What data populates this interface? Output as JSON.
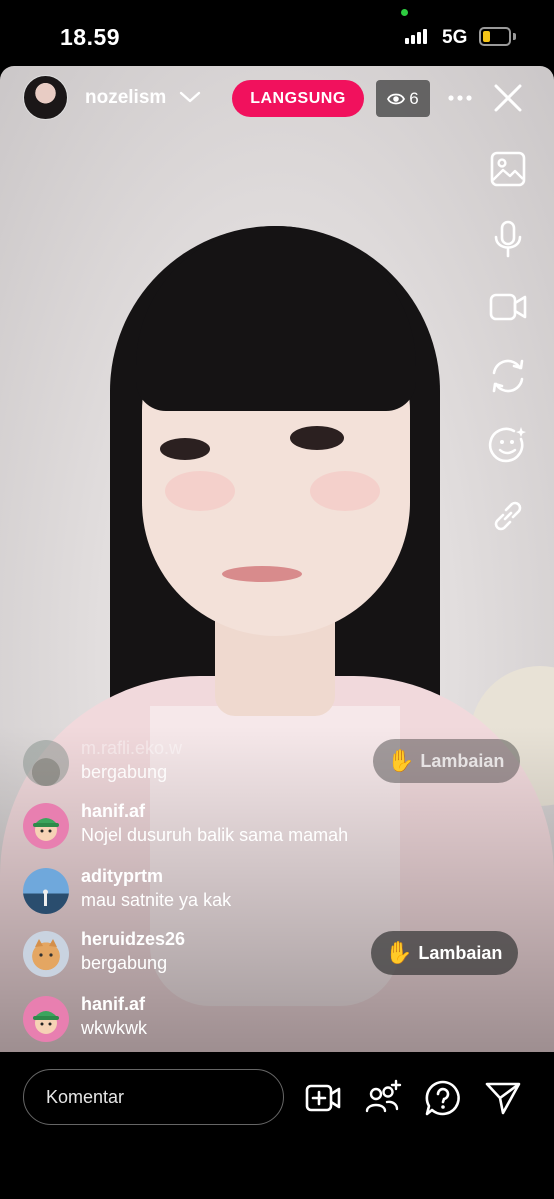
{
  "status_bar": {
    "time": "18.59",
    "network": "5G"
  },
  "header": {
    "host_name": "nozelism",
    "live_label": "LANGSUNG",
    "viewer_count": "6"
  },
  "chat": [
    {
      "user": "m.rafli.eko.w",
      "text": "bergabung"
    },
    {
      "user": "hanif.af",
      "text": "Nojel dusuruh balik sama mamah"
    },
    {
      "user": "adityprtm",
      "text": "mau satnite ya kak"
    },
    {
      "user": "heruidzes26",
      "text": "bergabung"
    },
    {
      "user": "hanif.af",
      "text": "wkwkwk"
    }
  ],
  "wave_buttons": [
    {
      "label": "Lambaian"
    },
    {
      "label": "Lambaian"
    }
  ],
  "composer": {
    "placeholder": "Komentar"
  },
  "colors": {
    "live": "#f1115d",
    "background": "#000000"
  },
  "icons": {
    "rail": [
      "image-icon",
      "microphone-icon",
      "video-camera-icon",
      "switch-camera-icon",
      "face-effects-icon",
      "link-icon"
    ],
    "bottom": [
      "add-video-icon",
      "add-guest-icon",
      "question-icon",
      "send-icon"
    ]
  }
}
